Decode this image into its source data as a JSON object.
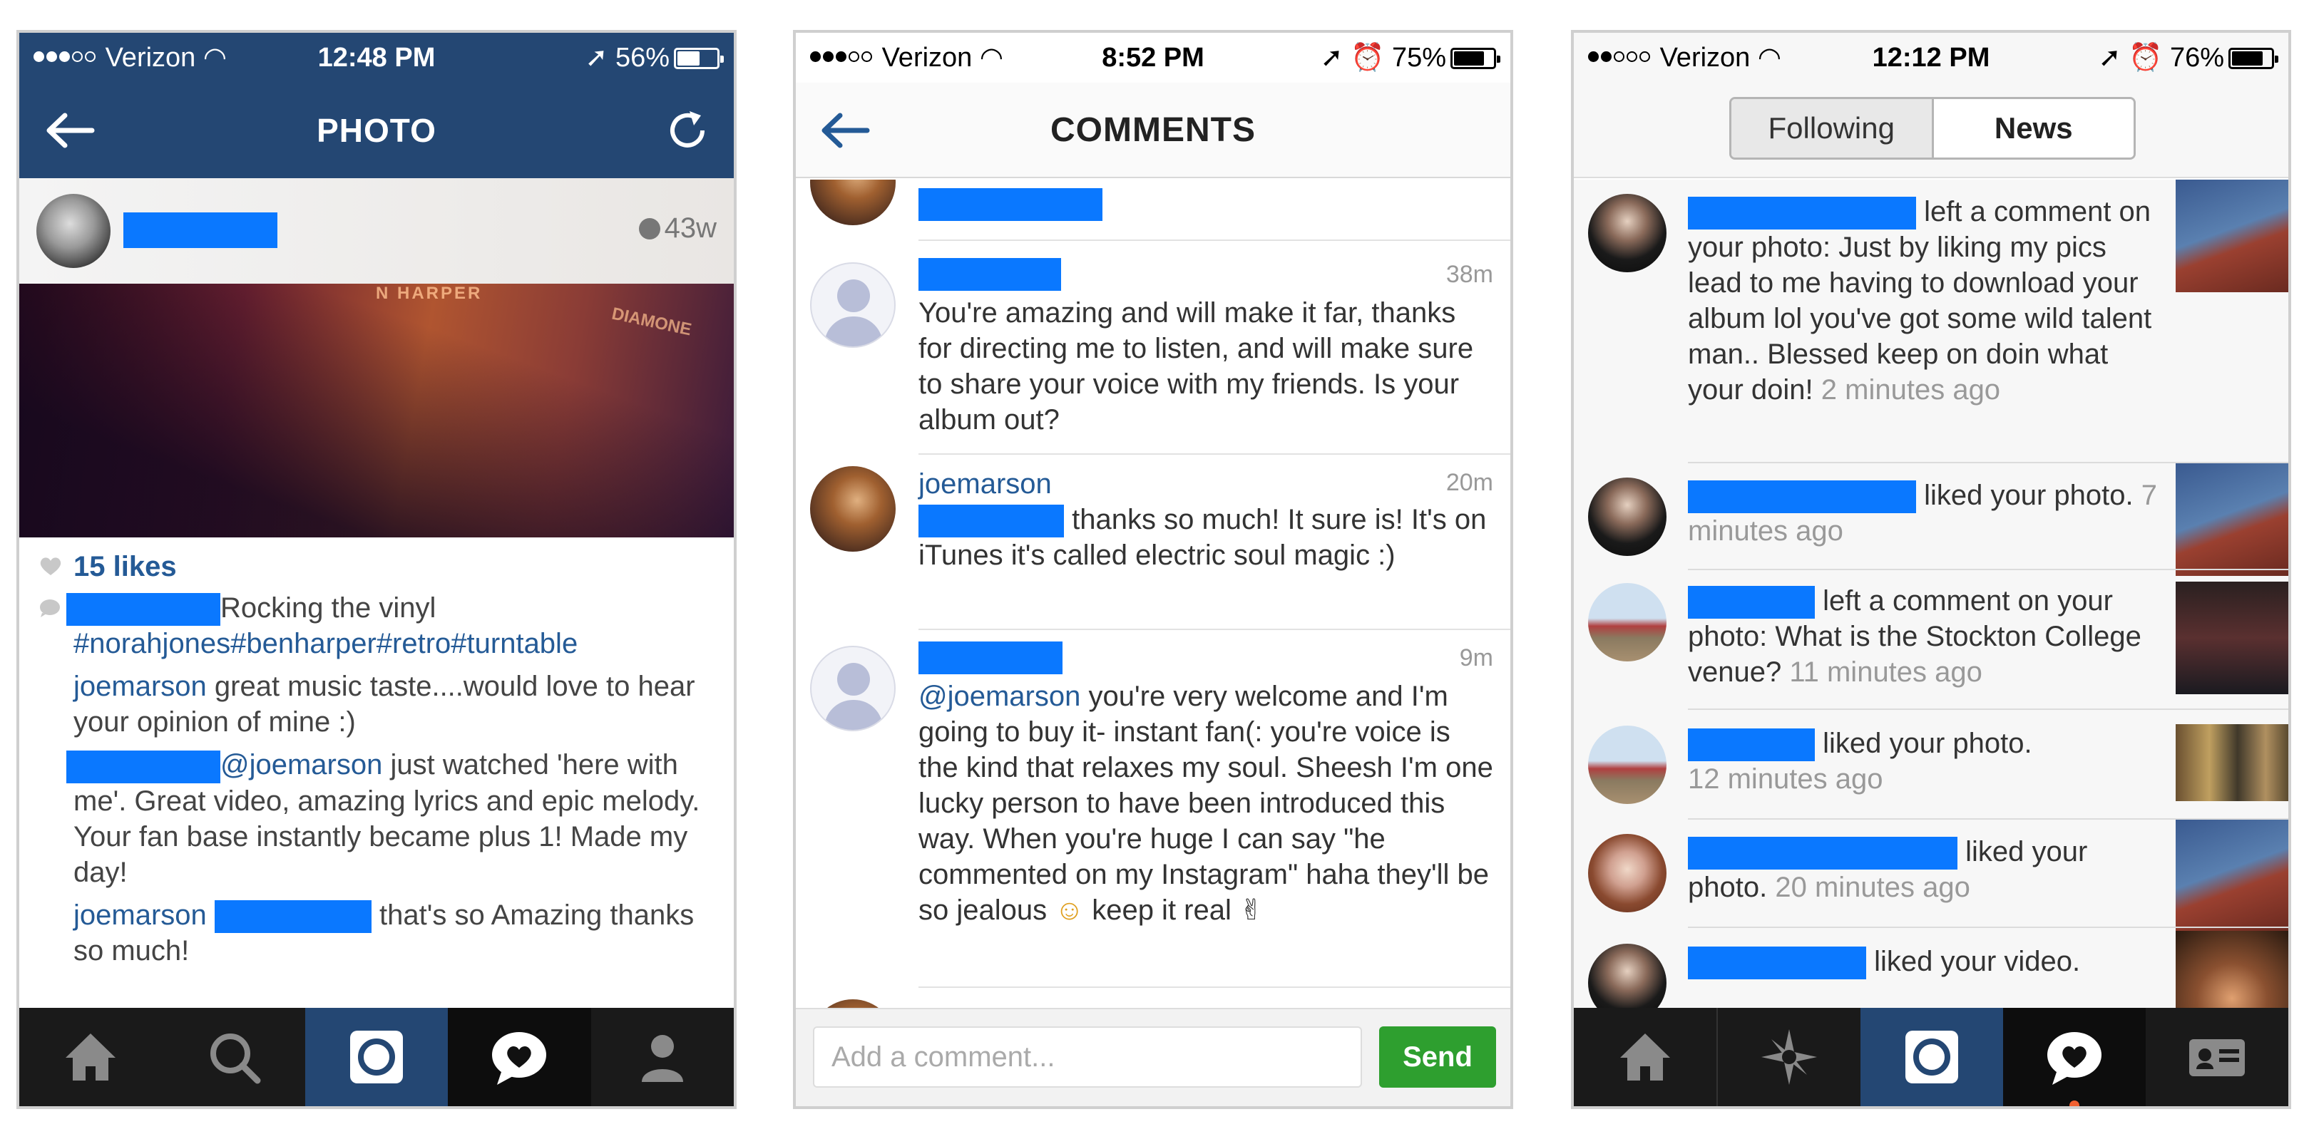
{
  "phone1": {
    "status": {
      "carrier": "Verizon",
      "time": "12:48 PM",
      "battery": "56%",
      "battery_level": 0.56
    },
    "title": "PHOTO",
    "post_age": "43w",
    "album_text_1": "N HARPER",
    "album_text_2": "DIAMONE",
    "likes": "15 likes",
    "caption": {
      "text": "Rocking the vinyl",
      "tags": "#norahjones#benharper#retro#turntable"
    },
    "comments": [
      {
        "user": "joemarson",
        "text": " great music taste....would love to hear your opinion of mine :)"
      },
      {
        "mention": "@joemarson",
        "text": " just  watched 'here with me'. Great video,  amazing lyrics and epic melody.  Your fan base instantly became plus 1! Made my day!"
      },
      {
        "user": "joemarson",
        "text": " that's so Amazing thanks so much!"
      }
    ],
    "tabs": [
      "home-icon",
      "search-icon",
      "camera-icon",
      "activity-icon",
      "profile-icon"
    ]
  },
  "phone2": {
    "status": {
      "carrier": "Verizon",
      "time": "8:52 PM",
      "battery": "75%",
      "battery_level": 0.75
    },
    "title": "COMMENTS",
    "comments": [
      {
        "time": "38m",
        "text": "You're amazing and will make it far, thanks for directing me to listen, and will make sure to share your voice with my friends. Is your album out?"
      },
      {
        "user": "joemarson",
        "time": "20m",
        "text": " thanks so much! It sure is! It's on iTunes it's called electric soul magic :)"
      },
      {
        "time": "9m",
        "mention": "@joemarson",
        "text": " you're very welcome and I'm going to buy it- instant fan(: you're voice is the kind that relaxes my soul. Sheesh I'm one lucky person to have been introduced this way. When you're huge I can say \"he commented on my Instagram\" haha they'll be so jealous",
        "emoji": "☺",
        "tail": " keep it real ✌"
      }
    ],
    "composer": {
      "placeholder": "Add a comment...",
      "send": "Send"
    }
  },
  "phone3": {
    "status": {
      "carrier": "Verizon",
      "time": "12:12 PM",
      "battery": "76%",
      "battery_level": 0.76
    },
    "tabs": {
      "following": "Following",
      "news": "News"
    },
    "notifications": [
      {
        "text": " left a comment on your photo: Just by liking my pics lead to me having to download your album lol you've got some wild talent man.. Blessed keep on doin what your doin!",
        "time": " 2 minutes ago"
      },
      {
        "text": " liked your photo.",
        "time": " 7 minutes ago"
      },
      {
        "text": " left a comment on your photo: What is the Stockton College venue?",
        "time": " 11 minutes ago"
      },
      {
        "text": " liked your photo.",
        "time": "12 minutes ago"
      },
      {
        "text": " liked your photo.",
        "time": " 20 minutes ago"
      },
      {
        "text": " liked your video.",
        "time": ""
      }
    ],
    "bottom_tabs": [
      "home-icon",
      "explore-icon",
      "camera-icon",
      "activity-icon",
      "profile-card-icon"
    ]
  },
  "colors": {
    "nav_blue": "#244773",
    "link_blue": "#245a96",
    "redaction": "#0a78ff",
    "send_green": "#2e9f2f"
  }
}
